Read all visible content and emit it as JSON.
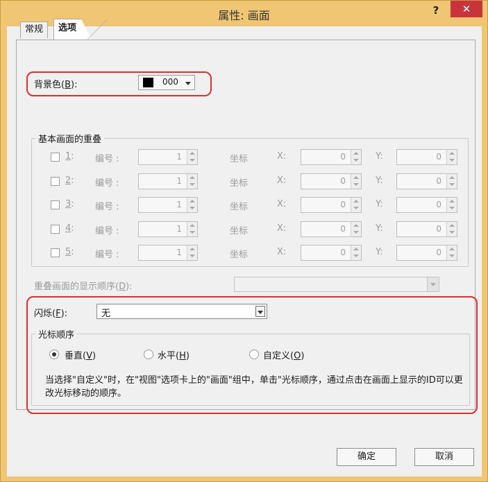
{
  "window": {
    "title": "属性: 画面",
    "help_label": "?",
    "close_label": "✕"
  },
  "tabs": [
    {
      "label": "常规"
    },
    {
      "label": "选项"
    }
  ],
  "background_color": {
    "label": "背景色(",
    "hotkey": "B",
    "suffix": "):",
    "value": "000",
    "swatch": "#000000"
  },
  "overlay": {
    "group_title": "基本画面的重叠",
    "rows": [
      {
        "num": "1",
        "suffix": ":",
        "number_label": "编号 :",
        "number_value": "1",
        "coord_label": "坐标",
        "x_label": "X:",
        "x_value": "0",
        "y_label": "Y:",
        "y_value": "0"
      },
      {
        "num": "2",
        "suffix": ":",
        "number_label": "编号 :",
        "number_value": "1",
        "coord_label": "坐标",
        "x_label": "X:",
        "x_value": "0",
        "y_label": "Y:",
        "y_value": "0"
      },
      {
        "num": "3",
        "suffix": ":",
        "number_label": "编号 :",
        "number_value": "1",
        "coord_label": "坐标",
        "x_label": "X:",
        "x_value": "0",
        "y_label": "Y:",
        "y_value": "0"
      },
      {
        "num": "4",
        "suffix": ":",
        "number_label": "编号 :",
        "number_value": "1",
        "coord_label": "坐标",
        "x_label": "X:",
        "x_value": "0",
        "y_label": "Y:",
        "y_value": "0"
      },
      {
        "num": "5",
        "suffix": ":",
        "number_label": "编号 :",
        "number_value": "1",
        "coord_label": "坐标",
        "x_label": "X:",
        "x_value": "0",
        "y_label": "Y:",
        "y_value": "0"
      }
    ],
    "order_label": "重叠画面的显示顺序(",
    "order_hotkey": "D",
    "order_suffix": "):"
  },
  "flash": {
    "label": "闪烁(",
    "hotkey": "F",
    "suffix": "):",
    "value": "无"
  },
  "cursor_order": {
    "group_title": "光标顺序",
    "options": [
      {
        "label": "垂直(",
        "hotkey": "V",
        "suffix": ")",
        "selected": true
      },
      {
        "label": "水平(",
        "hotkey": "H",
        "suffix": ")",
        "selected": false
      },
      {
        "label": "自定义(",
        "hotkey": "O",
        "suffix": ")",
        "selected": false
      }
    ],
    "note": "当选择\"自定义\"时，在\"视图\"选项卡上的\"画面\"组中，单击\"光标顺序，通过点击在画面上显示的ID可以更改光标移动的顺序。"
  },
  "buttons": {
    "ok": "确定",
    "cancel": "取消"
  },
  "colors": {
    "title_bar": "#f0c674",
    "close": "#c8343a",
    "highlight": "#d9302c"
  }
}
